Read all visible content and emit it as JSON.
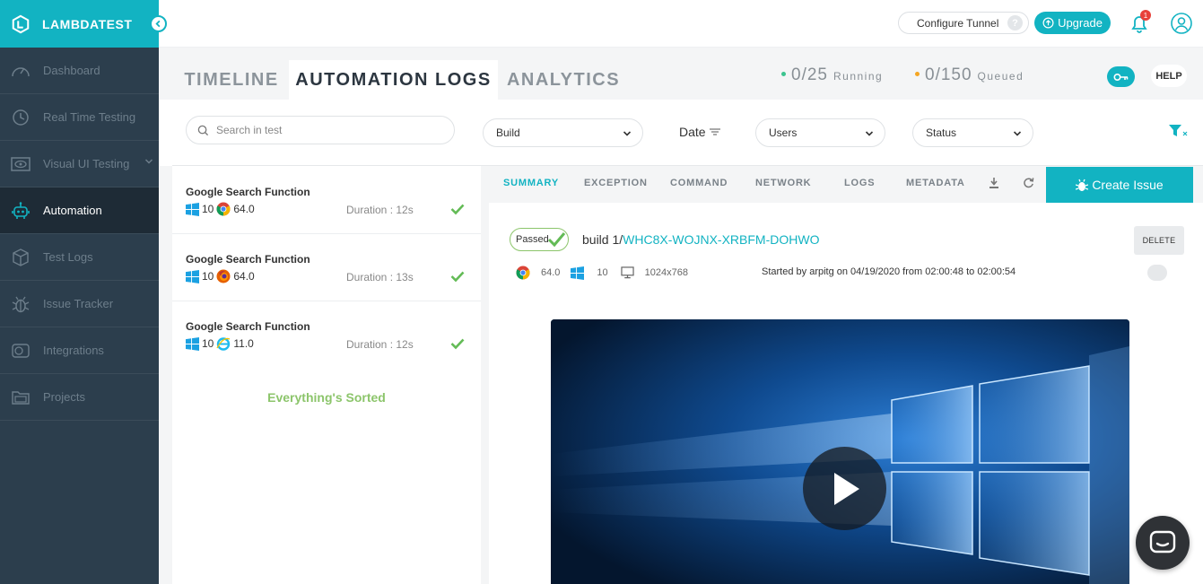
{
  "brand": {
    "name": "LAMBDATEST"
  },
  "sidebar": {
    "items": [
      {
        "label": "Dashboard"
      },
      {
        "label": "Real Time Testing"
      },
      {
        "label": "Visual UI Testing"
      },
      {
        "label": "Automation"
      },
      {
        "label": "Test Logs"
      },
      {
        "label": "Issue Tracker"
      },
      {
        "label": "Integrations"
      },
      {
        "label": "Projects"
      }
    ]
  },
  "topbar": {
    "tunnel_label": "Configure Tunnel",
    "tunnel_help": "?",
    "upgrade_label": "Upgrade",
    "notification_count": "1"
  },
  "tabs": [
    {
      "label": "TIMELINE"
    },
    {
      "label": "AUTOMATION LOGS"
    },
    {
      "label": "ANALYTICS"
    }
  ],
  "stats": {
    "running": {
      "value": "0/25",
      "label": "Running",
      "color": "#3cc48f"
    },
    "queued": {
      "value": "0/150",
      "label": "Queued",
      "color": "#f5a623"
    }
  },
  "help_label": "HELP",
  "filters": {
    "search_placeholder": "Search in test",
    "build": "Build",
    "date": "Date",
    "users": "Users",
    "status": "Status"
  },
  "tests": [
    {
      "name": "Google Search Function",
      "os_version": "10",
      "browser": "chrome",
      "browser_version": "64.0",
      "duration": "Duration : 12s"
    },
    {
      "name": "Google Search Function",
      "os_version": "10",
      "browser": "firefox",
      "browser_version": "64.0",
      "duration": "Duration : 13s"
    },
    {
      "name": "Google Search Function",
      "os_version": "10",
      "browser": "ie",
      "browser_version": "11.0",
      "duration": "Duration : 12s"
    }
  ],
  "sorted_message": "Everything's Sorted",
  "detail": {
    "subtabs": [
      {
        "label": "SUMMARY"
      },
      {
        "label": "EXCEPTION"
      },
      {
        "label": "COMMAND"
      },
      {
        "label": "NETWORK"
      },
      {
        "label": "LOGS"
      },
      {
        "label": "METADATA"
      }
    ],
    "create_issue_label": "Create Issue",
    "status_label": "Passed",
    "build_prefix": "build 1/",
    "build_id": "WHC8X-WOJNX-XRBFM-DOHWO",
    "delete_label": "DELETE",
    "browser_version": "64.0",
    "os_version": "10",
    "resolution": "1024x768",
    "started_text": "Started by arpitg on 04/19/2020 from 02:00:48 to 02:00:54"
  },
  "colors": {
    "accent": "#12b3c2",
    "sidebar": "#2c3e4d",
    "success": "#8cc56b"
  }
}
